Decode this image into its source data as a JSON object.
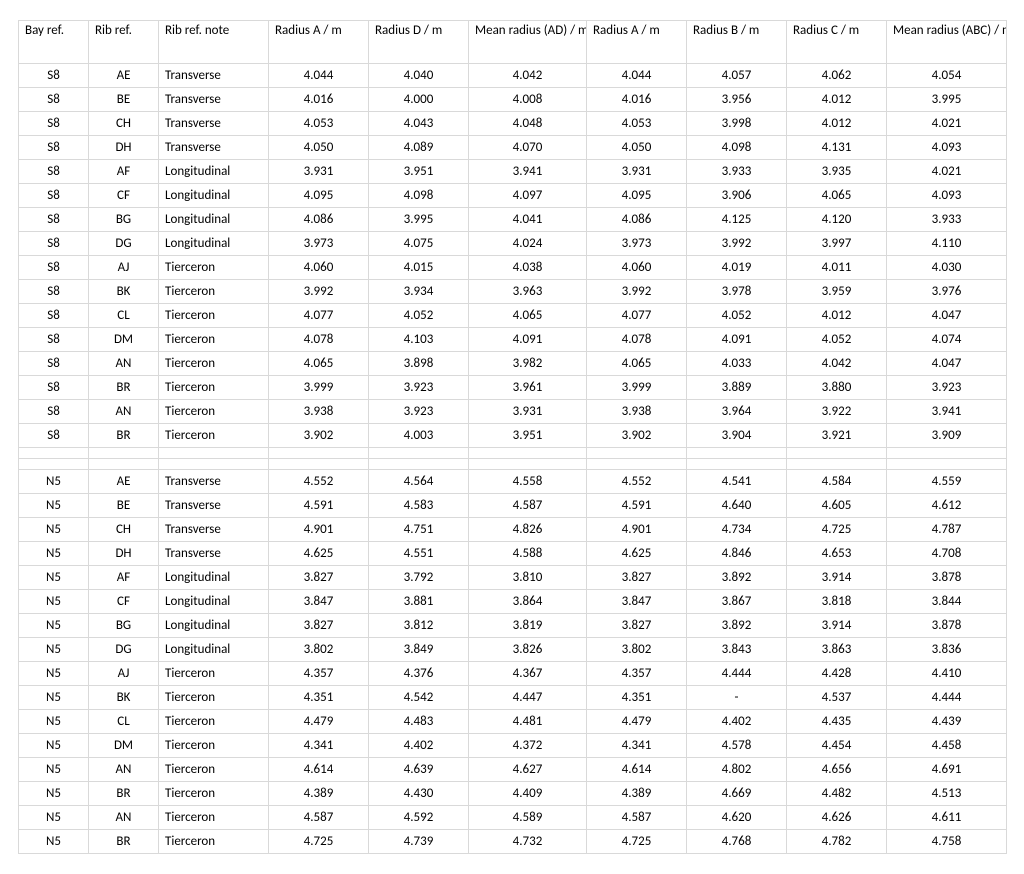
{
  "headers": [
    "Bay ref.",
    "Rib ref.",
    "Rib ref. note",
    "Radius A\n/ m",
    "Radius D\n/ m",
    "Mean radius\n(AD) / m",
    "Radius A\n/ m",
    "Radius B\n/ m",
    "Radius C\n/ m",
    "Mean radius\n(ABC) / m"
  ],
  "rows": [
    {
      "bay": "S8",
      "rib": "AE",
      "note": "Transverse",
      "ra": "4.044",
      "rd": "4.040",
      "mad": "4.042",
      "ra2": "4.044",
      "rb": "4.057",
      "rc": "4.062",
      "mabc": "4.054"
    },
    {
      "bay": "S8",
      "rib": "BE",
      "note": "Transverse",
      "ra": "4.016",
      "rd": "4.000",
      "mad": "4.008",
      "ra2": "4.016",
      "rb": "3.956",
      "rc": "4.012",
      "mabc": "3.995"
    },
    {
      "bay": "S8",
      "rib": "CH",
      "note": "Transverse",
      "ra": "4.053",
      "rd": "4.043",
      "mad": "4.048",
      "ra2": "4.053",
      "rb": "3.998",
      "rc": "4.012",
      "mabc": "4.021"
    },
    {
      "bay": "S8",
      "rib": "DH",
      "note": "Transverse",
      "ra": "4.050",
      "rd": "4.089",
      "mad": "4.070",
      "ra2": "4.050",
      "rb": "4.098",
      "rc": "4.131",
      "mabc": "4.093"
    },
    {
      "bay": "S8",
      "rib": "AF",
      "note": "Longitudinal",
      "ra": "3.931",
      "rd": "3.951",
      "mad": "3.941",
      "ra2": "3.931",
      "rb": "3.933",
      "rc": "3.935",
      "mabc": "4.021"
    },
    {
      "bay": "S8",
      "rib": "CF",
      "note": "Longitudinal",
      "ra": "4.095",
      "rd": "4.098",
      "mad": "4.097",
      "ra2": "4.095",
      "rb": "3.906",
      "rc": "4.065",
      "mabc": "4.093"
    },
    {
      "bay": "S8",
      "rib": "BG",
      "note": "Longitudinal",
      "ra": "4.086",
      "rd": "3.995",
      "mad": "4.041",
      "ra2": "4.086",
      "rb": "4.125",
      "rc": "4.120",
      "mabc": "3.933"
    },
    {
      "bay": "S8",
      "rib": "DG",
      "note": "Longitudinal",
      "ra": "3.973",
      "rd": "4.075",
      "mad": "4.024",
      "ra2": "3.973",
      "rb": "3.992",
      "rc": "3.997",
      "mabc": "4.110"
    },
    {
      "bay": "S8",
      "rib": "AJ",
      "note": "Tierceron",
      "ra": "4.060",
      "rd": "4.015",
      "mad": "4.038",
      "ra2": "4.060",
      "rb": "4.019",
      "rc": "4.011",
      "mabc": "4.030"
    },
    {
      "bay": "S8",
      "rib": "BK",
      "note": "Tierceron",
      "ra": "3.992",
      "rd": "3.934",
      "mad": "3.963",
      "ra2": "3.992",
      "rb": "3.978",
      "rc": "3.959",
      "mabc": "3.976"
    },
    {
      "bay": "S8",
      "rib": "CL",
      "note": "Tierceron",
      "ra": "4.077",
      "rd": "4.052",
      "mad": "4.065",
      "ra2": "4.077",
      "rb": "4.052",
      "rc": "4.012",
      "mabc": "4.047"
    },
    {
      "bay": "S8",
      "rib": "DM",
      "note": "Tierceron",
      "ra": "4.078",
      "rd": "4.103",
      "mad": "4.091",
      "ra2": "4.078",
      "rb": "4.091",
      "rc": "4.052",
      "mabc": "4.074"
    },
    {
      "bay": "S8",
      "rib": "AN",
      "note": "Tierceron",
      "ra": "4.065",
      "rd": "3.898",
      "mad": "3.982",
      "ra2": "4.065",
      "rb": "4.033",
      "rc": "4.042",
      "mabc": "4.047"
    },
    {
      "bay": "S8",
      "rib": "BR",
      "note": "Tierceron",
      "ra": "3.999",
      "rd": "3.923",
      "mad": "3.961",
      "ra2": "3.999",
      "rb": "3.889",
      "rc": "3.880",
      "mabc": "3.923"
    },
    {
      "bay": "S8",
      "rib": "AN",
      "note": "Tierceron",
      "ra": "3.938",
      "rd": "3.923",
      "mad": "3.931",
      "ra2": "3.938",
      "rb": "3.964",
      "rc": "3.922",
      "mabc": "3.941"
    },
    {
      "bay": "S8",
      "rib": "BR",
      "note": "Tierceron",
      "ra": "3.902",
      "rd": "4.003",
      "mad": "3.951",
      "ra2": "3.902",
      "rb": "3.904",
      "rc": "3.921",
      "mabc": "3.909"
    },
    {
      "blank": true
    },
    {
      "blank": true
    },
    {
      "bay": "N5",
      "rib": "AE",
      "note": "Transverse",
      "ra": "4.552",
      "rd": "4.564",
      "mad": "4.558",
      "ra2": "4.552",
      "rb": "4.541",
      "rc": "4.584",
      "mabc": "4.559"
    },
    {
      "bay": "N5",
      "rib": "BE",
      "note": "Transverse",
      "ra": "4.591",
      "rd": "4.583",
      "mad": "4.587",
      "ra2": "4.591",
      "rb": "4.640",
      "rc": "4.605",
      "mabc": "4.612"
    },
    {
      "bay": "N5",
      "rib": "CH",
      "note": "Transverse",
      "ra": "4.901",
      "rd": "4.751",
      "mad": "4.826",
      "ra2": "4.901",
      "rb": "4.734",
      "rc": "4.725",
      "mabc": "4.787"
    },
    {
      "bay": "N5",
      "rib": "DH",
      "note": "Transverse",
      "ra": "4.625",
      "rd": "4.551",
      "mad": "4.588",
      "ra2": "4.625",
      "rb": "4.846",
      "rc": "4.653",
      "mabc": "4.708"
    },
    {
      "bay": "N5",
      "rib": "AF",
      "note": "Longitudinal",
      "ra": "3.827",
      "rd": "3.792",
      "mad": "3.810",
      "ra2": "3.827",
      "rb": "3.892",
      "rc": "3.914",
      "mabc": "3.878"
    },
    {
      "bay": "N5",
      "rib": "CF",
      "note": "Longitudinal",
      "ra": "3.847",
      "rd": "3.881",
      "mad": "3.864",
      "ra2": "3.847",
      "rb": "3.867",
      "rc": "3.818",
      "mabc": "3.844"
    },
    {
      "bay": "N5",
      "rib": "BG",
      "note": "Longitudinal",
      "ra": "3.827",
      "rd": "3.812",
      "mad": "3.819",
      "ra2": "3.827",
      "rb": "3.892",
      "rc": "3.914",
      "mabc": "3.878"
    },
    {
      "bay": "N5",
      "rib": "DG",
      "note": "Longitudinal",
      "ra": "3.802",
      "rd": "3.849",
      "mad": "3.826",
      "ra2": "3.802",
      "rb": "3.843",
      "rc": "3.863",
      "mabc": "3.836"
    },
    {
      "bay": "N5",
      "rib": "AJ",
      "note": "Tierceron",
      "ra": "4.357",
      "rd": "4.376",
      "mad": "4.367",
      "ra2": "4.357",
      "rb": "4.444",
      "rc": "4.428",
      "mabc": "4.410"
    },
    {
      "bay": "N5",
      "rib": "BK",
      "note": "Tierceron",
      "ra": "4.351",
      "rd": "4.542",
      "mad": "4.447",
      "ra2": "4.351",
      "rb": "-",
      "rc": "4.537",
      "mabc": "4.444"
    },
    {
      "bay": "N5",
      "rib": "CL",
      "note": "Tierceron",
      "ra": "4.479",
      "rd": "4.483",
      "mad": "4.481",
      "ra2": "4.479",
      "rb": "4.402",
      "rc": "4.435",
      "mabc": "4.439"
    },
    {
      "bay": "N5",
      "rib": "DM",
      "note": "Tierceron",
      "ra": "4.341",
      "rd": "4.402",
      "mad": "4.372",
      "ra2": "4.341",
      "rb": "4.578",
      "rc": "4.454",
      "mabc": "4.458"
    },
    {
      "bay": "N5",
      "rib": "AN",
      "note": "Tierceron",
      "ra": "4.614",
      "rd": "4.639",
      "mad": "4.627",
      "ra2": "4.614",
      "rb": "4.802",
      "rc": "4.656",
      "mabc": "4.691"
    },
    {
      "bay": "N5",
      "rib": "BR",
      "note": "Tierceron",
      "ra": "4.389",
      "rd": "4.430",
      "mad": "4.409",
      "ra2": "4.389",
      "rb": "4.669",
      "rc": "4.482",
      "mabc": "4.513"
    },
    {
      "bay": "N5",
      "rib": "AN",
      "note": "Tierceron",
      "ra": "4.587",
      "rd": "4.592",
      "mad": "4.589",
      "ra2": "4.587",
      "rb": "4.620",
      "rc": "4.626",
      "mabc": "4.611"
    },
    {
      "bay": "N5",
      "rib": "BR",
      "note": "Tierceron",
      "ra": "4.725",
      "rd": "4.739",
      "mad": "4.732",
      "ra2": "4.725",
      "rb": "4.768",
      "rc": "4.782",
      "mabc": "4.758"
    }
  ]
}
